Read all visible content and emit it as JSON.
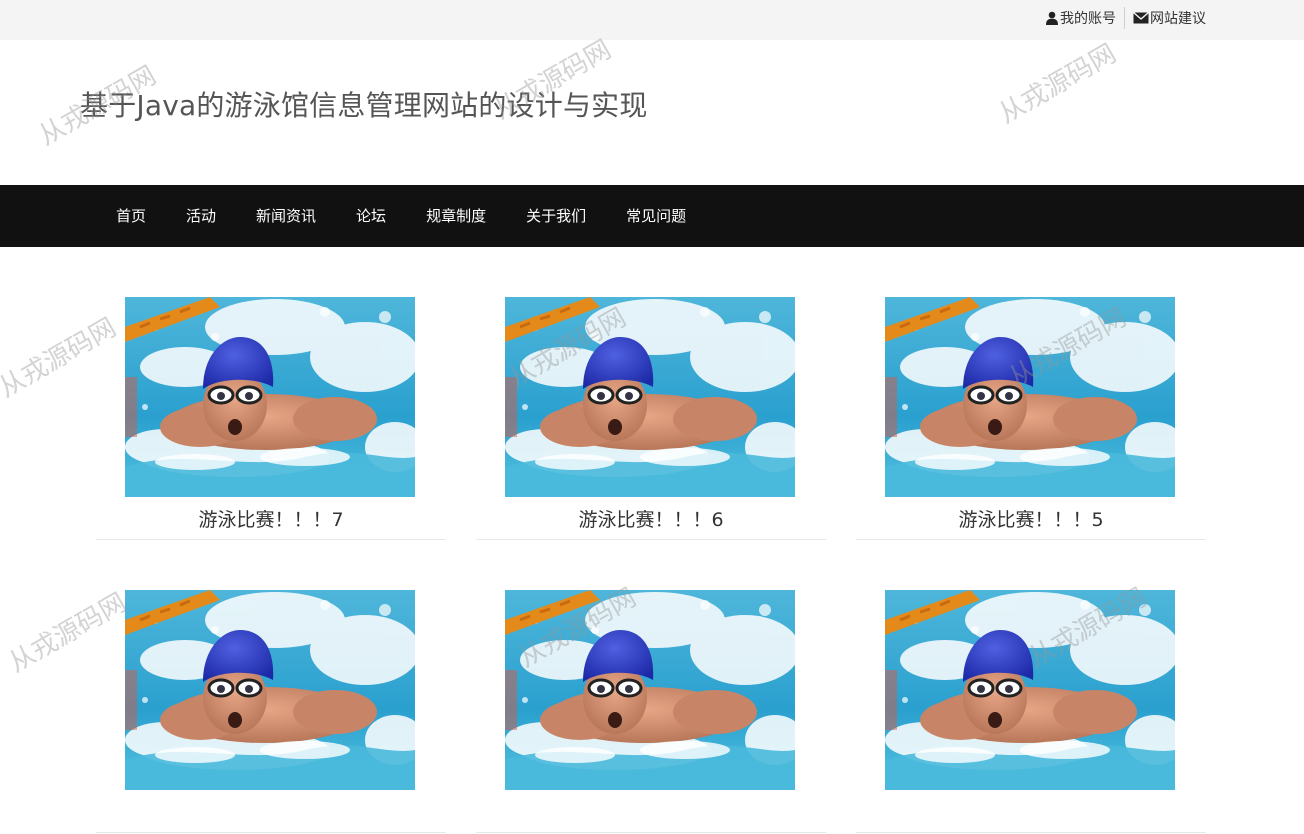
{
  "topbar": {
    "account_label": "我的账号",
    "feedback_label": "网站建议"
  },
  "site_title": "基于Java的游泳馆信息管理网站的设计与实现",
  "nav": {
    "items": [
      "首页",
      "活动",
      "新闻资讯",
      "论坛",
      "规章制度",
      "关于我们",
      "常见问题"
    ]
  },
  "cards": [
    {
      "title": "游泳比赛！！！7",
      "image": "swimmer-butterfly-photo"
    },
    {
      "title": "游泳比赛！！！6",
      "image": "swimmer-butterfly-photo"
    },
    {
      "title": "游泳比赛！！！5",
      "image": "swimmer-butterfly-photo"
    },
    {
      "title": "",
      "image": "swimmer-butterfly-photo"
    },
    {
      "title": "",
      "image": "swimmer-butterfly-photo"
    },
    {
      "title": "",
      "image": "swimmer-butterfly-photo"
    }
  ],
  "watermark": "从戎源码网",
  "icons": {
    "account": "user-icon",
    "feedback": "envelope-icon"
  }
}
